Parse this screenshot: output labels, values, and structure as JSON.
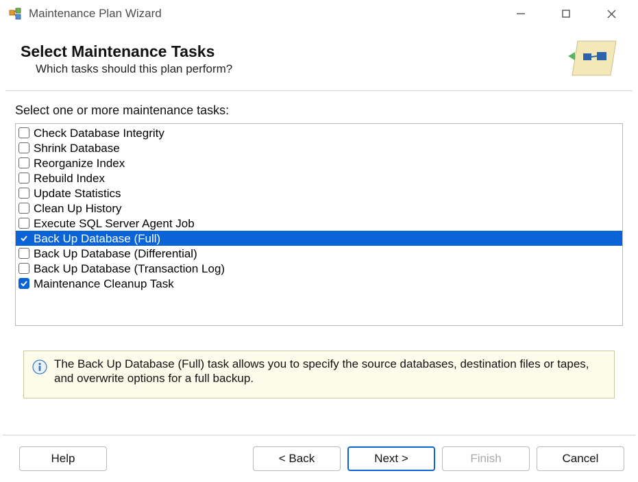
{
  "window": {
    "title": "Maintenance Plan Wizard"
  },
  "header": {
    "title": "Select Maintenance Tasks",
    "subtitle": "Which tasks should this plan perform?"
  },
  "content": {
    "list_label": "Select one or more maintenance tasks:",
    "tasks": [
      {
        "label": "Check Database Integrity",
        "checked": false,
        "selected": false
      },
      {
        "label": "Shrink Database",
        "checked": false,
        "selected": false
      },
      {
        "label": "Reorganize Index",
        "checked": false,
        "selected": false
      },
      {
        "label": "Rebuild Index",
        "checked": false,
        "selected": false
      },
      {
        "label": "Update Statistics",
        "checked": false,
        "selected": false
      },
      {
        "label": "Clean Up History",
        "checked": false,
        "selected": false
      },
      {
        "label": "Execute SQL Server Agent Job",
        "checked": false,
        "selected": false
      },
      {
        "label": "Back Up Database (Full)",
        "checked": true,
        "selected": true
      },
      {
        "label": "Back Up Database (Differential)",
        "checked": false,
        "selected": false
      },
      {
        "label": "Back Up Database (Transaction Log)",
        "checked": false,
        "selected": false
      },
      {
        "label": "Maintenance Cleanup Task",
        "checked": true,
        "selected": false
      }
    ]
  },
  "info": {
    "text": "The Back Up Database (Full) task allows you to specify the source databases, destination files or tapes, and overwrite options for a full backup."
  },
  "footer": {
    "help": "Help",
    "back": "< Back",
    "next": "Next >",
    "finish": "Finish",
    "cancel": "Cancel"
  }
}
